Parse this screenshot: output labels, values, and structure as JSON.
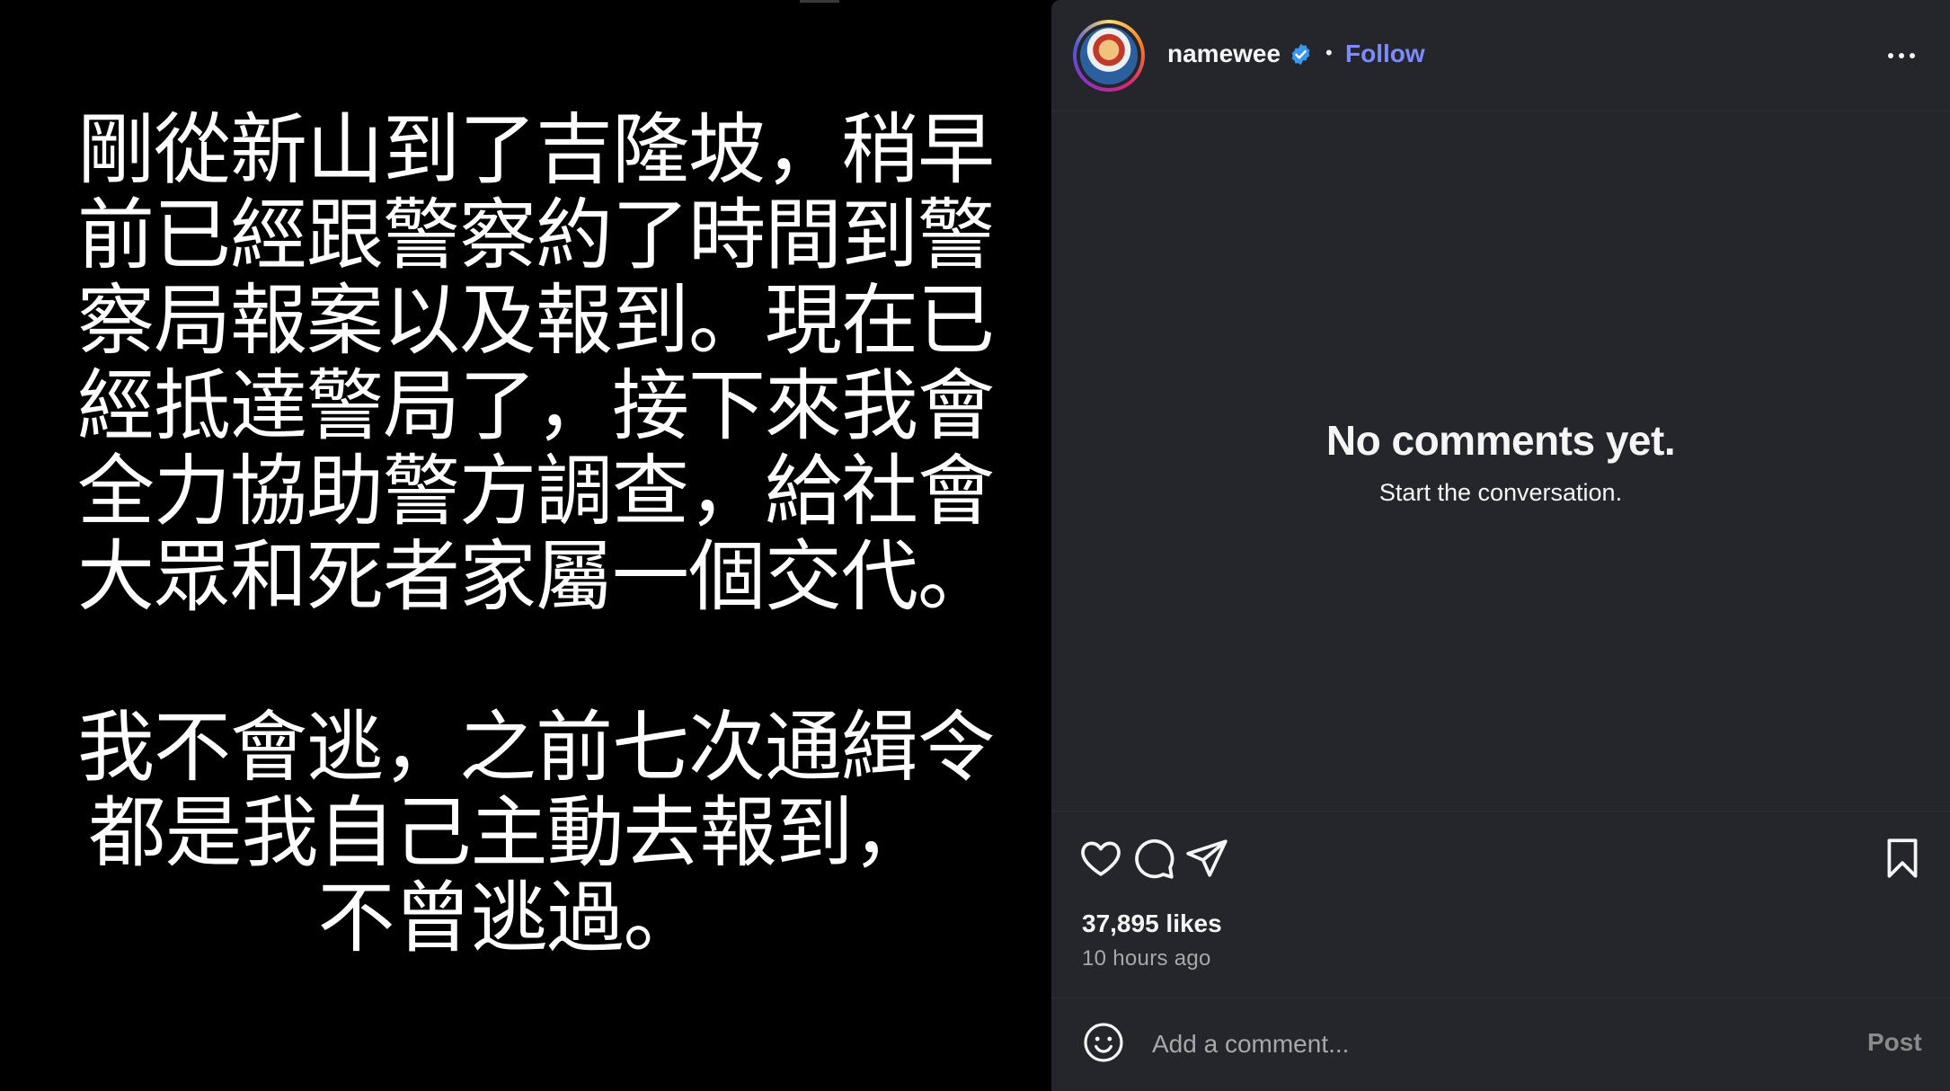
{
  "post": {
    "paragraph1": "剛從新山到了吉隆坡，稍早\n前已經跟警察約了時間到警\n察局報案以及報到。現在已\n經抵達警局了，接下來我會\n全力協助警方調查，給社會\n大眾和死者家屬一個交代。",
    "paragraph2": "我不會逃，之前七次通緝令\n都是我自己主動去報到，\n不曾逃過。"
  },
  "header": {
    "username": "namewee",
    "separator": "•",
    "follow_label": "Follow",
    "avatar_icon": "profile-avatar",
    "verified_icon": "verified-badge-icon",
    "more_icon": "more-options-icon"
  },
  "comments": {
    "empty_title": "No comments yet.",
    "empty_subtitle": "Start the conversation."
  },
  "actions": {
    "like_icon": "heart-icon",
    "comment_icon": "comment-icon",
    "share_icon": "share-icon",
    "save_icon": "bookmark-icon"
  },
  "stats": {
    "likes": "37,895 likes",
    "time": "10 hours ago"
  },
  "composer": {
    "placeholder": "Add a comment...",
    "post_label": "Post",
    "emoji_icon": "emoji-icon"
  },
  "colors": {
    "panel_bg": "#25262c",
    "accent": "#7c8cff",
    "verified": "#3897f0"
  }
}
